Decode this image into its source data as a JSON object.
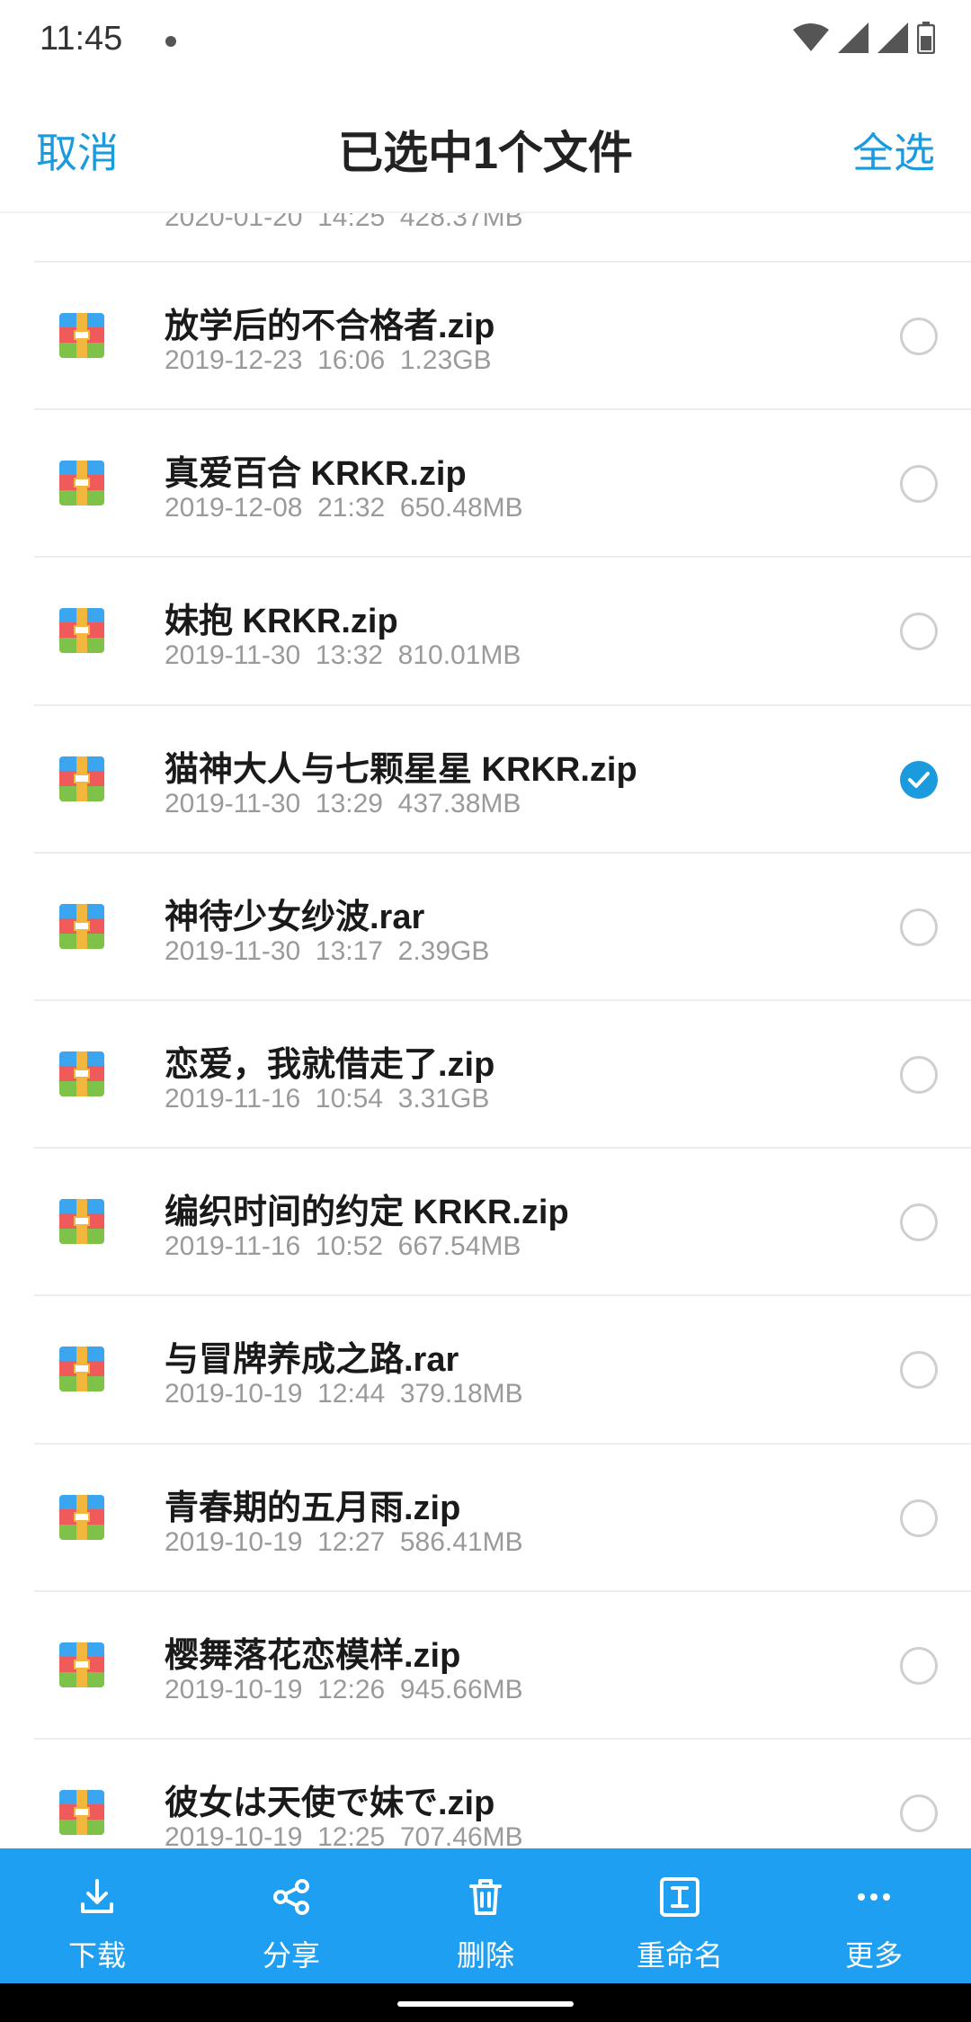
{
  "status_bar": {
    "time": "11:45"
  },
  "top_bar": {
    "cancel": "取消",
    "title": "已选中1个文件",
    "select_all": "全选"
  },
  "partial_row": {
    "meta": "2020-01-20  14:25  428.37MB"
  },
  "files": [
    {
      "name": "放学后的不合格者.zip",
      "meta": "2019-12-23  16:06  1.23GB",
      "checked": false
    },
    {
      "name": "真爱百合 KRKR.zip",
      "meta": "2019-12-08  21:32  650.48MB",
      "checked": false
    },
    {
      "name": "妹抱 KRKR.zip",
      "meta": "2019-11-30  13:32  810.01MB",
      "checked": false
    },
    {
      "name": "猫神大人与七颗星星 KRKR.zip",
      "meta": "2019-11-30  13:29  437.38MB",
      "checked": true
    },
    {
      "name": "神待少女纱波.rar",
      "meta": "2019-11-30  13:17  2.39GB",
      "checked": false
    },
    {
      "name": "恋爱，我就借走了.zip",
      "meta": "2019-11-16  10:54  3.31GB",
      "checked": false
    },
    {
      "name": "编织时间的约定 KRKR.zip",
      "meta": "2019-11-16  10:52  667.54MB",
      "checked": false
    },
    {
      "name": "与冒牌养成之路.rar",
      "meta": "2019-10-19  12:44  379.18MB",
      "checked": false
    },
    {
      "name": "青春期的五月雨.zip",
      "meta": "2019-10-19  12:27  586.41MB",
      "checked": false
    },
    {
      "name": "樱舞落花恋模样.zip",
      "meta": "2019-10-19  12:26  945.66MB",
      "checked": false
    },
    {
      "name": "彼女は天使で妹で.zip",
      "meta": "2019-10-19  12:25  707.46MB",
      "checked": false
    }
  ],
  "toolbar": {
    "download": "下载",
    "share": "分享",
    "delete": "删除",
    "rename": "重命名",
    "more": "更多"
  },
  "colors": {
    "accent": "#1a9bde",
    "toolbar_bg": "#1e9ff2"
  }
}
